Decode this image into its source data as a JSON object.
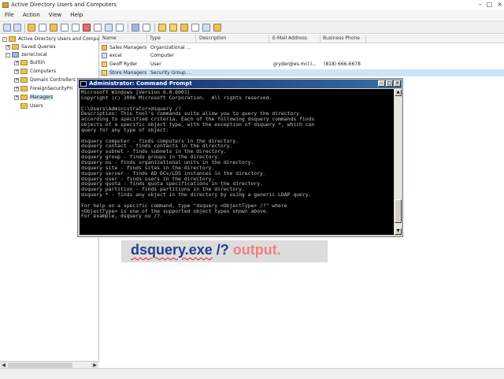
{
  "window": {
    "title": "Active Directory Users and Computers",
    "controls": [
      "–",
      "□",
      "×"
    ]
  },
  "menu": [
    "File",
    "Action",
    "View",
    "Help"
  ],
  "tree": {
    "items": [
      {
        "label": "Active Directory Users and Comput",
        "exp": "–"
      },
      {
        "label": "Saved Queries",
        "exp": "+"
      },
      {
        "label": "zerrel.local",
        "exp": "–"
      },
      {
        "label": "Builtin",
        "exp": "+"
      },
      {
        "label": "Computers",
        "exp": "+"
      },
      {
        "label": "Domain Controllers",
        "exp": "+"
      },
      {
        "label": "ForeignSecurityPri",
        "exp": "+"
      },
      {
        "label": "Managers",
        "exp": "+"
      },
      {
        "label": "Users",
        "exp": ""
      }
    ]
  },
  "list": {
    "columns": [
      "Name",
      "Type",
      "Description",
      "E-Mail Address",
      "Business Phone"
    ],
    "rows": [
      {
        "name": "Sales Managers",
        "type": "Organizational ...",
        "description": "",
        "email": "",
        "phone": ""
      },
      {
        "name": "excel",
        "type": "Computer",
        "description": "",
        "email": "",
        "phone": ""
      },
      {
        "name": "Geoff Ryder",
        "type": "User",
        "description": "",
        "email": "gryder@es.mcl.l...",
        "phone": "(818) 666-6678"
      },
      {
        "name": "Store Managers",
        "type": "Security Group ...",
        "description": "",
        "email": "",
        "phone": ""
      }
    ]
  },
  "cmd": {
    "title": "Administrator: Command Prompt",
    "lines": [
      "Microsoft Windows [Version 6.0.6001]",
      "Copyright (c) 2006 Microsoft Corporation.  All rights reserved.",
      "",
      "C:\\Users\\Administrator>dsquery /?",
      "Description: This tool's commands suite allow you to query the directory",
      "according to specified criteria. Each of the following dsquery commands finds",
      "objects of a specific object type, with the exception of dsquery *, which can",
      "query for any type of object:",
      "",
      "dsquery computer - finds computers in the directory.",
      "dsquery contact - finds contacts in the directory.",
      "dsquery subnet - finds subnets in the directory.",
      "dsquery group - finds groups in the directory.",
      "dsquery ou - finds organizational units in the directory.",
      "dsquery site - finds sites in the directory.",
      "dsquery server - finds AD DCs/LDS instances in the directory.",
      "dsquery user - finds users in the directory.",
      "dsquery quota - finds quota specifications in the directory.",
      "dsquery partition - finds partitions in the directory.",
      "dsquery * - finds any object in the directory by using a generic LDAP query.",
      "",
      "For help on a specific command, type \"dsquery <ObjectType> /?\" where",
      "<ObjectType> is one of the supported object types shown above.",
      "For example, dsquery ou /?."
    ]
  },
  "caption": {
    "command": "dsquery.exe",
    "args": " /?",
    "output": " output."
  },
  "colors": {
    "cmd_bg": "#000000",
    "cmd_text": "#c0c0c0",
    "caption_text": "#233d8c",
    "caption_accent": "#f08080",
    "titlebar": "#0a246a"
  }
}
